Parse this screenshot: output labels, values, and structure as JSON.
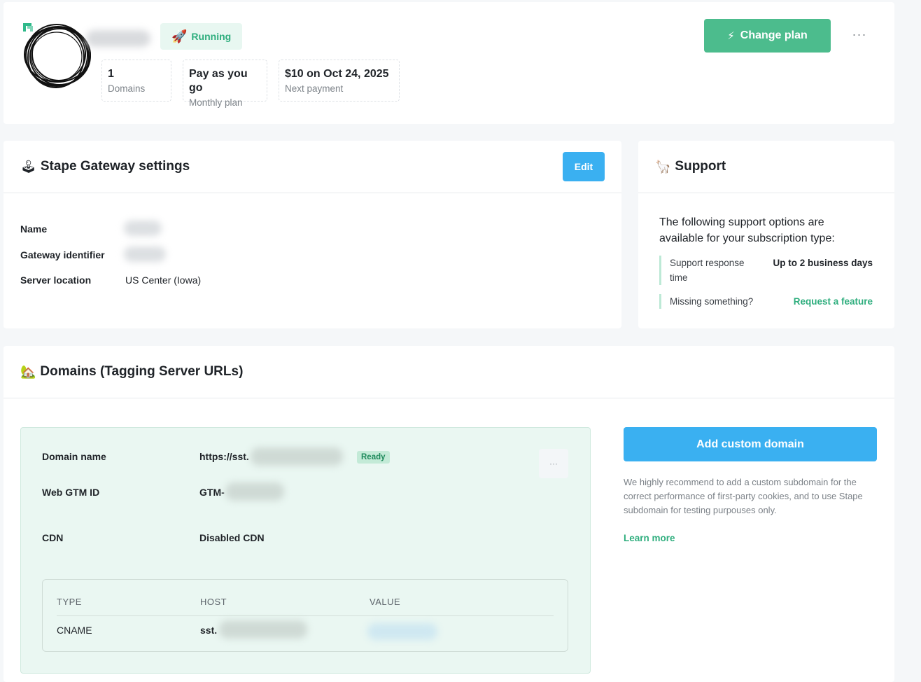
{
  "header": {
    "status": {
      "icon": "rocket-icon",
      "emoji": "🚀",
      "label": "Running"
    },
    "stats": [
      {
        "value": "1",
        "label": "Domains"
      },
      {
        "value": "Pay as you go",
        "label": "Monthly plan"
      },
      {
        "value": "$10 on Oct 24, 2025",
        "label": "Next payment"
      }
    ],
    "change_plan": {
      "icon": "lightning-icon",
      "emoji": "⚡",
      "label": "Change plan"
    },
    "more_label": "···"
  },
  "gateway": {
    "title": "Stape Gateway settings",
    "title_emoji": "🕹",
    "edit_label": "Edit",
    "fields": {
      "name_label": "Name",
      "identifier_label": "Gateway identifier",
      "location_label": "Server location",
      "location_value": "US Center (Iowa)"
    }
  },
  "support": {
    "title": "Support",
    "title_emoji": "🦙",
    "intro": "The following support options are available for your subscription type:",
    "response_label": "Support response time",
    "response_value": "Up to 2 business days",
    "missing_label": "Missing something?",
    "request_link": "Request a feature"
  },
  "domains": {
    "title": "Domains (Tagging Server URLs)",
    "title_emoji": "🏡",
    "entry": {
      "domain_label": "Domain name",
      "domain_value": "https://sst.",
      "status": "Ready",
      "gtm_label": "Web GTM ID",
      "gtm_value": "GTM-",
      "cdn_label": "CDN",
      "cdn_value": "Disabled CDN",
      "menu_label": "···"
    },
    "dns_table": {
      "headers": [
        "TYPE",
        "HOST",
        "VALUE"
      ],
      "row": {
        "type": "CNAME",
        "host": "sst."
      }
    },
    "add_button": "Add custom domain",
    "note": "We highly recommend to add a custom subdomain for the correct performance of first-party cookies, and to use Stape subdomain for testing purpouses only.",
    "learn_more": "Learn more"
  },
  "colors": {
    "brand_green": "#4cbc8d",
    "accent_blue": "#3ab0f1",
    "link_green": "#2fae7e",
    "domain_bg": "#eaf7f2"
  }
}
